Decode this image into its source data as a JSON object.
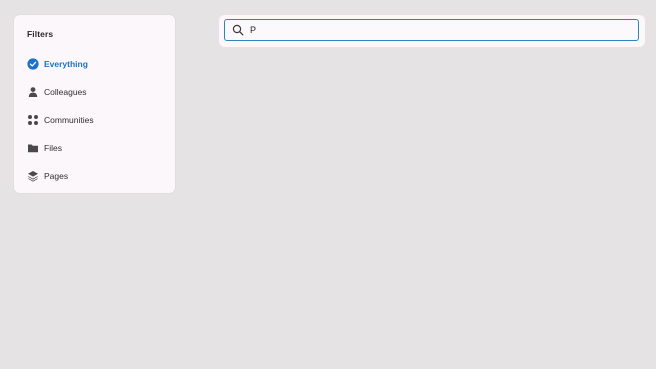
{
  "filters": {
    "title": "Filters",
    "selected_color": "#1b72c6",
    "items": [
      {
        "label": "Everything",
        "icon": "check-circle-icon",
        "selected": true
      },
      {
        "label": "Colleagues",
        "icon": "person-icon",
        "selected": false
      },
      {
        "label": "Communities",
        "icon": "communities-icon",
        "selected": false
      },
      {
        "label": "Files",
        "icon": "folder-icon",
        "selected": false
      },
      {
        "label": "Pages",
        "icon": "layers-icon",
        "selected": false
      }
    ]
  },
  "search": {
    "value": "P",
    "icon": "search-icon",
    "border_color": "#2c86bd"
  }
}
